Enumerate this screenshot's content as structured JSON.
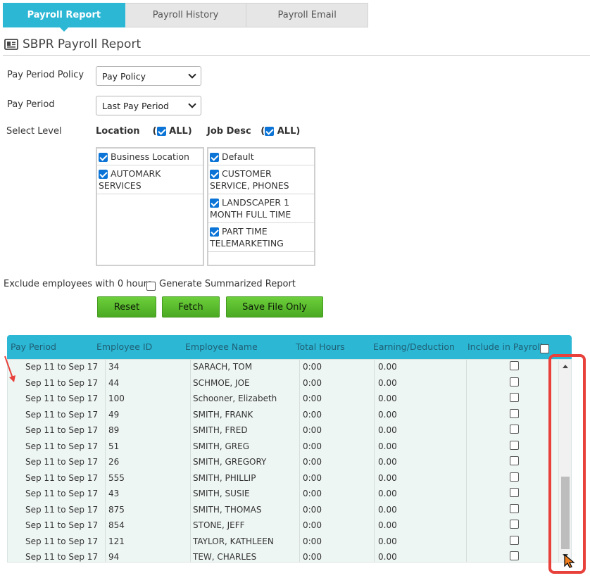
{
  "tabs": [
    "Payroll Report",
    "Payroll History",
    "Payroll Email"
  ],
  "page_title": "SBPR Payroll Report",
  "form": {
    "pay_period_policy_label": "Pay Period Policy",
    "pay_period_policy_value": "Pay Policy",
    "pay_period_label": "Pay Period",
    "pay_period_value": "Last Pay Period",
    "select_level_label": "Select Level",
    "location_label": "Location",
    "location_all": "ALL)",
    "job_desc_label": "Job Desc",
    "job_desc_all": "ALL)",
    "open_paren": "(",
    "locations": [
      "Business Location",
      "AUTOMARK SERVICES"
    ],
    "job_descs": [
      "Default",
      "CUSTOMER SERVICE, PHONES",
      "LANDSCAPER 1 MONTH FULL TIME",
      "PART TIME TELEMARKETING"
    ],
    "exclude_label": "Exclude employees with 0 hours",
    "summarized_label": "Generate Summarized Report"
  },
  "buttons": {
    "reset": "Reset",
    "fetch": "Fetch",
    "save": "Save File Only"
  },
  "table": {
    "headers": [
      "Pay Period",
      "Employee ID",
      "Employee Name",
      "Total Hours",
      "Earning/Deduction",
      "Include in Payroll"
    ],
    "rows": [
      [
        "Sep 11 to Sep 17",
        "34",
        "SARACH, TOM",
        "0:00",
        "0.00"
      ],
      [
        "Sep 11 to Sep 17",
        "44",
        "SCHMOE, JOE",
        "0:00",
        "0.00"
      ],
      [
        "Sep 11 to Sep 17",
        "100",
        "Schooner, Elizabeth",
        "0:00",
        "0.00"
      ],
      [
        "Sep 11 to Sep 17",
        "49",
        "SMITH, FRANK",
        "0:00",
        "0.00"
      ],
      [
        "Sep 11 to Sep 17",
        "89",
        "SMITH, FRED",
        "0:00",
        "0.00"
      ],
      [
        "Sep 11 to Sep 17",
        "51",
        "SMITH, GREG",
        "0:00",
        "0.00"
      ],
      [
        "Sep 11 to Sep 17",
        "26",
        "SMITH, GREGORY",
        "0:00",
        "0.00"
      ],
      [
        "Sep 11 to Sep 17",
        "555",
        "SMITH, PHILLIP",
        "0:00",
        "0.00"
      ],
      [
        "Sep 11 to Sep 17",
        "43",
        "SMITH, SUSIE",
        "0:00",
        "0.00"
      ],
      [
        "Sep 11 to Sep 17",
        "875",
        "SMITH, THOMAS",
        "0:00",
        "0.00"
      ],
      [
        "Sep 11 to Sep 17",
        "854",
        "STONE, JEFF",
        "0:00",
        "0.00"
      ],
      [
        "Sep 11 to Sep 17",
        "121",
        "TAYLOR, KATHLEEN",
        "0:00",
        "0.00"
      ],
      [
        "Sep 11 to Sep 17",
        "94",
        "TEW, CHARLES",
        "0:00",
        "0.00"
      ]
    ]
  },
  "colors": {
    "accent": "#2cb7d5",
    "button_green": "#5cbf2e",
    "highlight": "#e8413b"
  },
  "icons": {
    "title": "id-card-icon"
  }
}
